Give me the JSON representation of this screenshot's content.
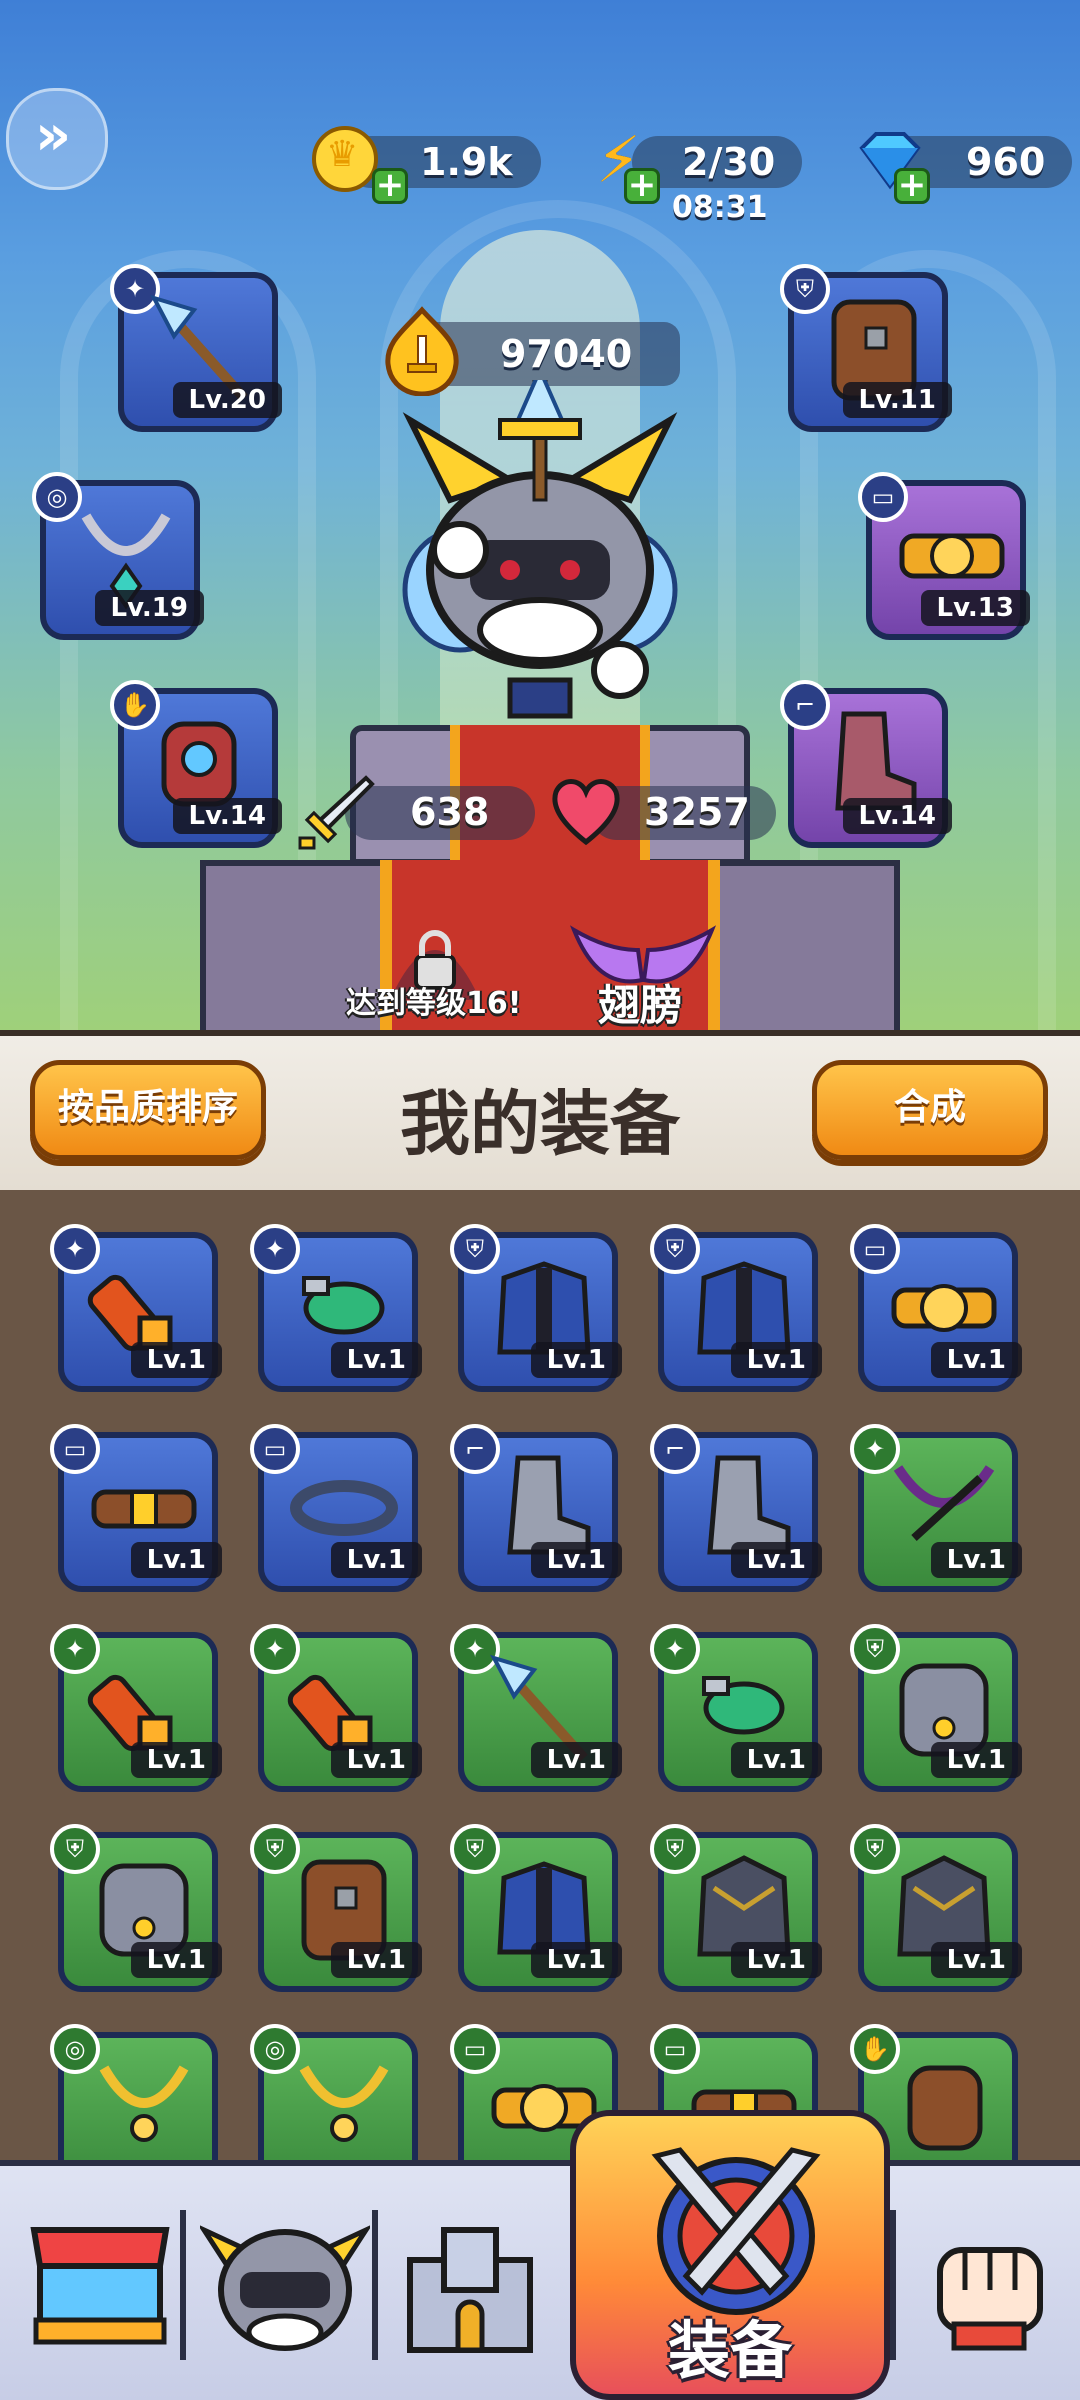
{
  "resources": {
    "gold": "1.9k",
    "energy": "2/30",
    "energy_timer": "08:31",
    "gems": "960"
  },
  "power": "97040",
  "stats": {
    "attack": "638",
    "hp": "3257"
  },
  "equipped_slots": [
    {
      "type": "weapon",
      "level": "Lv.20",
      "rarity": "blue",
      "icon": "ice-spear-icon"
    },
    {
      "type": "armor",
      "level": "Lv.11",
      "rarity": "blue",
      "icon": "leather-armor-icon"
    },
    {
      "type": "necklace",
      "level": "Lv.19",
      "rarity": "blue",
      "icon": "necklace-icon"
    },
    {
      "type": "belt",
      "level": "Lv.13",
      "rarity": "purple",
      "icon": "golden-belt-icon"
    },
    {
      "type": "glove",
      "level": "Lv.14",
      "rarity": "blue",
      "icon": "gauntlet-icon"
    },
    {
      "type": "boots",
      "level": "Lv.14",
      "rarity": "purple",
      "icon": "boots-icon"
    }
  ],
  "locked_slot": {
    "text": "达到等级16!"
  },
  "wings_label": "翅膀",
  "header": {
    "sort_button": "按品质排序",
    "title": "我的装备",
    "merge_button": "合成"
  },
  "inventory": [
    {
      "level": "Lv.1",
      "rarity": "blue",
      "icon": "flamethrower-icon"
    },
    {
      "level": "Lv.1",
      "rarity": "blue",
      "icon": "green-blaster-icon"
    },
    {
      "level": "Lv.1",
      "rarity": "blue",
      "icon": "blue-jacket-icon"
    },
    {
      "level": "Lv.1",
      "rarity": "blue",
      "icon": "blue-jacket-icon"
    },
    {
      "level": "Lv.1",
      "rarity": "blue",
      "icon": "golden-belt-icon"
    },
    {
      "level": "Lv.1",
      "rarity": "blue",
      "icon": "leather-belt-icon"
    },
    {
      "level": "Lv.1",
      "rarity": "blue",
      "icon": "chain-belt-icon"
    },
    {
      "level": "Lv.1",
      "rarity": "blue",
      "icon": "boots-icon"
    },
    {
      "level": "Lv.1",
      "rarity": "blue",
      "icon": "boots-icon"
    },
    {
      "level": "Lv.1",
      "rarity": "green",
      "icon": "crossbow-icon"
    },
    {
      "level": "Lv.1",
      "rarity": "green",
      "icon": "flamethrower-icon"
    },
    {
      "level": "Lv.1",
      "rarity": "green",
      "icon": "flamethrower-icon"
    },
    {
      "level": "Lv.1",
      "rarity": "green",
      "icon": "ice-spear-icon"
    },
    {
      "level": "Lv.1",
      "rarity": "green",
      "icon": "green-blaster-icon"
    },
    {
      "level": "Lv.1",
      "rarity": "green",
      "icon": "steel-armor-icon"
    },
    {
      "level": "Lv.1",
      "rarity": "green",
      "icon": "steel-armor-icon"
    },
    {
      "level": "Lv.1",
      "rarity": "green",
      "icon": "leather-armor-icon"
    },
    {
      "level": "Lv.1",
      "rarity": "green",
      "icon": "blue-jacket-icon"
    },
    {
      "level": "Lv.1",
      "rarity": "green",
      "icon": "spiked-armor-icon"
    },
    {
      "level": "Lv.1",
      "rarity": "green",
      "icon": "spiked-armor-icon"
    },
    {
      "level": "",
      "rarity": "green",
      "icon": "necklace-icon"
    },
    {
      "level": "",
      "rarity": "green",
      "icon": "necklace-icon"
    },
    {
      "level": "",
      "rarity": "green",
      "icon": "golden-belt-icon"
    },
    {
      "level": "",
      "rarity": "green",
      "icon": "leather-belt-icon"
    },
    {
      "level": "",
      "rarity": "green",
      "icon": "gauntlet-icon"
    }
  ],
  "nav": {
    "equip_label": "装备"
  },
  "colors": {
    "blue": "#3f63c6",
    "purple": "#8c58c2",
    "green": "#4a9e4a",
    "orange": "#f6a12a"
  }
}
